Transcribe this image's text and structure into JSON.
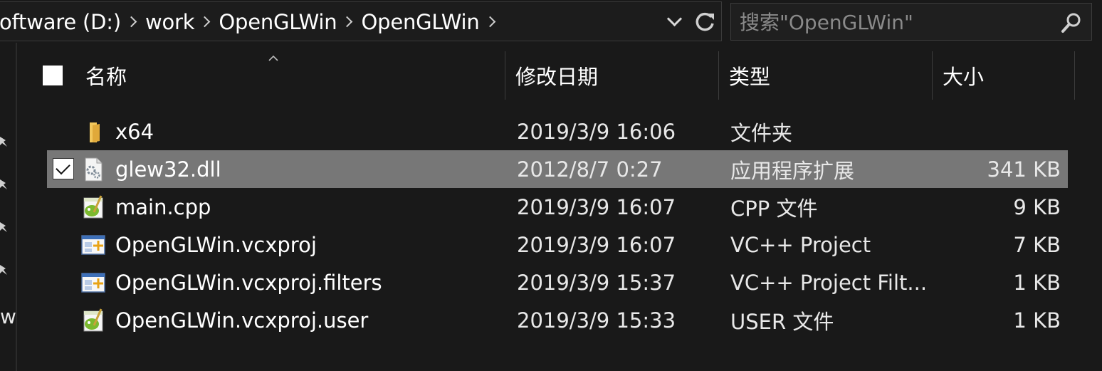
{
  "address_bar": {
    "breadcrumbs": [
      "oftware (D:)",
      "work",
      "OpenGLWin",
      "OpenGLWin"
    ]
  },
  "search": {
    "placeholder": "搜索\"OpenGLWin\""
  },
  "columns": {
    "name": "名称",
    "date_modified": "修改日期",
    "type": "类型",
    "size": "大小"
  },
  "nav_pane": {
    "cut_label": "w"
  },
  "files": [
    {
      "name": "x64",
      "date": "2019/3/9 16:06",
      "type": "文件夹",
      "size": "",
      "icon": "folder-icon",
      "selected": false
    },
    {
      "name": "glew32.dll",
      "date": "2012/8/7 0:27",
      "type": "应用程序扩展",
      "size": "341 KB",
      "icon": "dll-gear-icon",
      "selected": true
    },
    {
      "name": "main.cpp",
      "date": "2019/3/9 16:07",
      "type": "CPP 文件",
      "size": "9 KB",
      "icon": "notepadpp-icon",
      "selected": false
    },
    {
      "name": "OpenGLWin.vcxproj",
      "date": "2019/3/9 16:07",
      "type": "VC++ Project",
      "size": "7 KB",
      "icon": "vcproject-icon",
      "selected": false
    },
    {
      "name": "OpenGLWin.vcxproj.filters",
      "date": "2019/3/9 15:37",
      "type": "VC++ Project Filt...",
      "size": "1 KB",
      "icon": "vcproject-icon",
      "selected": false
    },
    {
      "name": "OpenGLWin.vcxproj.user",
      "date": "2019/3/9 15:33",
      "type": "USER 文件",
      "size": "1 KB",
      "icon": "notepadpp-icon",
      "selected": false
    }
  ],
  "colors": {
    "background": "#191919",
    "selected_row": "#777777",
    "folder_yellow": "#e8b84a"
  }
}
